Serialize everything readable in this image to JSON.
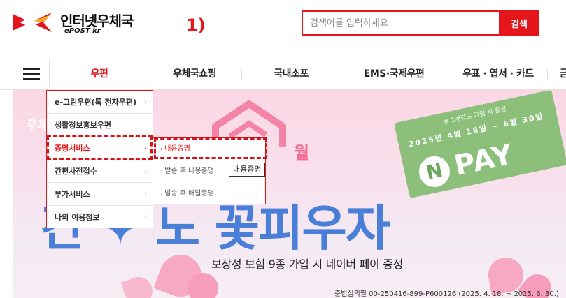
{
  "header": {
    "logo_ko": "인터넷우체국",
    "logo_en": "ePOST kr",
    "step_label": "1)",
    "search": {
      "placeholder": "검색어를 입력하세요",
      "button": "검색"
    }
  },
  "nav": {
    "items": [
      {
        "label": "우편",
        "active": true
      },
      {
        "label": "우체국쇼핑"
      },
      {
        "label": "국내소포"
      },
      {
        "label": "EMS·국제우편"
      },
      {
        "label": "우표 · 엽서 · 카드"
      },
      {
        "label": "금"
      }
    ]
  },
  "menu": {
    "items": [
      {
        "label": "e-그린우편(톡 전자우편)",
        "chevron": "›"
      },
      {
        "label": "생활정보홍보우편",
        "chevron": ""
      },
      {
        "label": "증명서비스",
        "chevron": "›",
        "selected": true
      },
      {
        "label": "간편사전접수",
        "chevron": "›"
      },
      {
        "label": "부가서비스",
        "chevron": "›"
      },
      {
        "label": "나의 이용정보",
        "chevron": "›"
      }
    ],
    "submenu": [
      {
        "label": "내용증명",
        "selected": true
      },
      {
        "label": "발송 후 내용증명"
      },
      {
        "label": "발송 후 배달증명"
      }
    ],
    "tooltip": "내용증명"
  },
  "banner": {
    "corner": "우체",
    "wol": "월",
    "headline": "간 ✦ 노 꽃피우자",
    "subtitle": "보장성 보험 9종 가입 시 네이버 페이 증정",
    "note": "준법심의필 00-250416-899-P600126 (2025. 4. 18. ~ 2025. 6. 30.)",
    "voucher": {
      "note": "※ 1계좌도 가입 시 증정",
      "date": "2025년 4월 18일 ~ 6월 30일",
      "n": "N",
      "pay": "PAY"
    }
  },
  "colors": {
    "brand": "#e4161b",
    "banner_blue": "#4a7fd8",
    "voucher_green": "#8cc07a"
  }
}
